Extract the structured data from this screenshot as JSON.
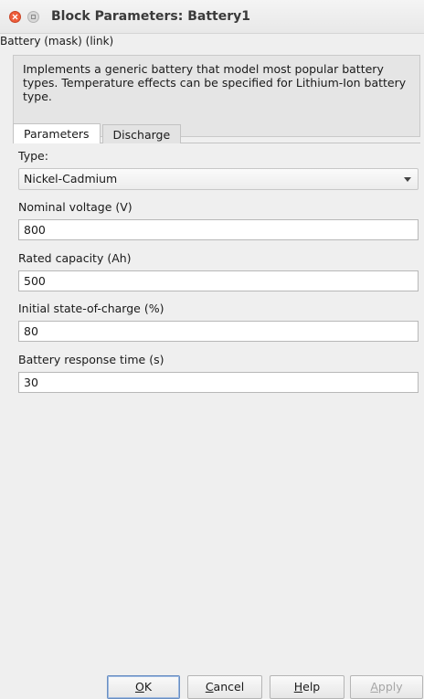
{
  "window": {
    "title": "Block Parameters: Battery1"
  },
  "mask_label": "Battery (mask) (link)",
  "description": "Implements a generic battery that model most popular battery types. Temperature effects can be specified for Lithium-Ion battery type.",
  "tabs": [
    {
      "label": "Parameters",
      "active": true
    },
    {
      "label": "Discharge",
      "active": false
    }
  ],
  "fields": {
    "type": {
      "label": "Type:",
      "value": "Nickel-Cadmium"
    },
    "nominal_voltage": {
      "label": "Nominal voltage (V)",
      "value": "800"
    },
    "rated_capacity": {
      "label": "Rated capacity (Ah)",
      "value": "500"
    },
    "initial_soc": {
      "label": "Initial state-of-charge (%)",
      "value": "80"
    },
    "response_time": {
      "label": "Battery response time (s)",
      "value": "30"
    }
  },
  "buttons": {
    "ok": {
      "mnemonic": "O",
      "rest": "K"
    },
    "cancel": {
      "mnemonic": "C",
      "rest": "ancel"
    },
    "help": {
      "mnemonic": "H",
      "rest": "elp"
    },
    "apply": {
      "mnemonic": "A",
      "rest": "pply"
    }
  },
  "icons": {
    "close": "close-icon",
    "maximize": "maximize-icon",
    "dropdown": "chevron-down-icon"
  }
}
